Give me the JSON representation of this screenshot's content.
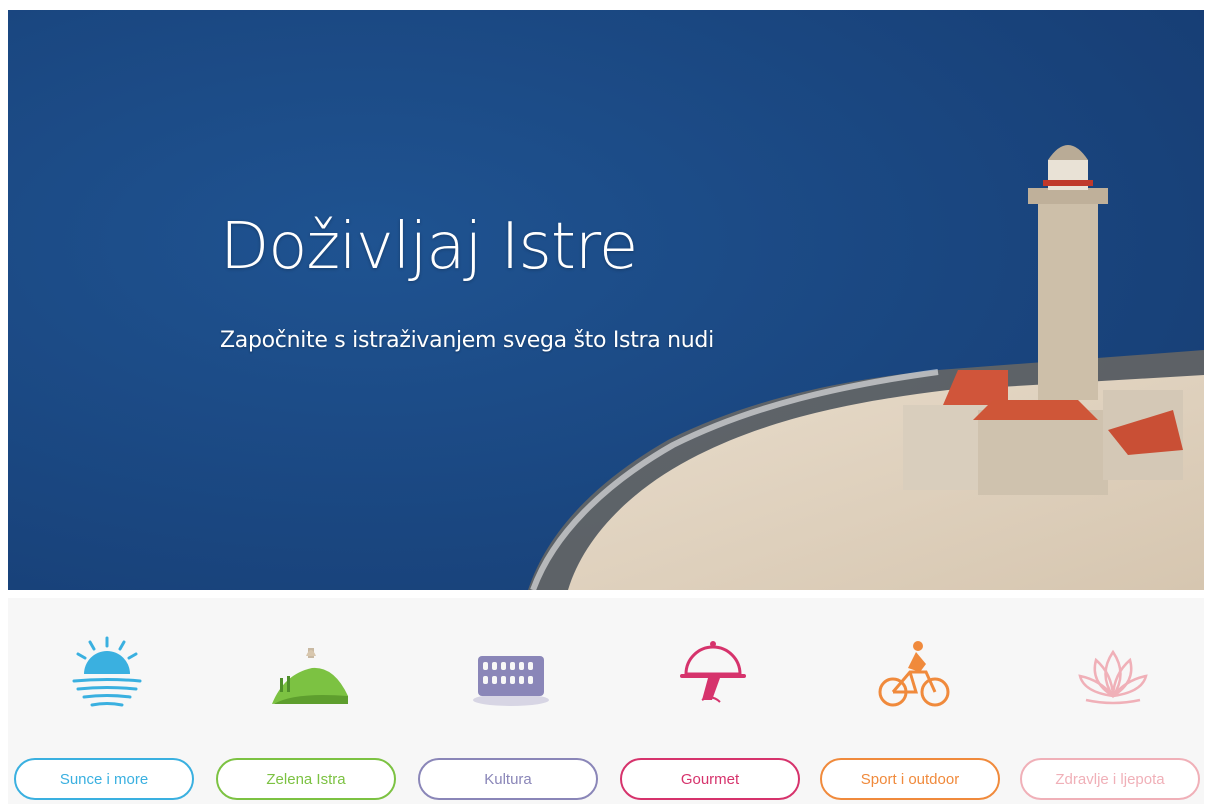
{
  "hero": {
    "title": "Doživljaj Istre",
    "subtitle": "Započnite s istraživanjem svega što Istra nudi"
  },
  "categories": [
    {
      "label": "Sunce i more",
      "icon": "sun-sea-icon",
      "color": "#3ab0e0"
    },
    {
      "label": "Zelena Istra",
      "icon": "green-hill-icon",
      "color": "#7cc242"
    },
    {
      "label": "Kultura",
      "icon": "colosseum-icon",
      "color": "#8a86b8"
    },
    {
      "label": "Gourmet",
      "icon": "cloche-icon",
      "color": "#d6336c"
    },
    {
      "label": "Sport i outdoor",
      "icon": "cyclist-icon",
      "color": "#f08a3c"
    },
    {
      "label": "Zdravlje i ljepota",
      "icon": "lotus-icon",
      "color": "#f0b0b8"
    }
  ]
}
